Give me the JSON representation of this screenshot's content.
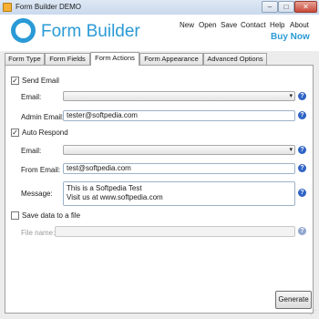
{
  "window": {
    "title": "Form Builder DEMO",
    "minimize": "–",
    "maximize": "□",
    "close": "✕"
  },
  "header": {
    "logo_text": "Form Builder",
    "menu": {
      "new": "New",
      "open": "Open",
      "save": "Save",
      "contact": "Contact",
      "help": "Help",
      "about": "About"
    },
    "buy_now": "Buy Now"
  },
  "tabs": [
    "Form Type",
    "Form Fields",
    "Form Actions",
    "Form Appearance",
    "Advanced Options"
  ],
  "active_tab": "Form Actions",
  "send_email": {
    "label": "Send Email",
    "checked": true,
    "email_label": "Email:",
    "email_value": "",
    "admin_email_label": "Admin Email:",
    "admin_email_value": "tester@softpedia.com"
  },
  "auto_respond": {
    "label": "Auto Respond",
    "checked": true,
    "email_label": "Email:",
    "email_value": "",
    "from_email_label": "From Email:",
    "from_email_value": "test@softpedia.com",
    "message_label": "Message:",
    "message_lines": [
      "This is a Softpedia Test",
      "Visit us at www.softpedia.com"
    ]
  },
  "save_to_file": {
    "label": "Save data to a file",
    "checked": false,
    "file_name_label": "File name:",
    "file_name_value": ""
  },
  "generate_button": "Generate",
  "icons": {
    "help": "?",
    "dropdown_arrow": "▾",
    "check": "✓",
    "resize_grip": "⋰"
  },
  "colors": {
    "accent": "#2a9ad6",
    "help_icon": "#2f63c5"
  }
}
